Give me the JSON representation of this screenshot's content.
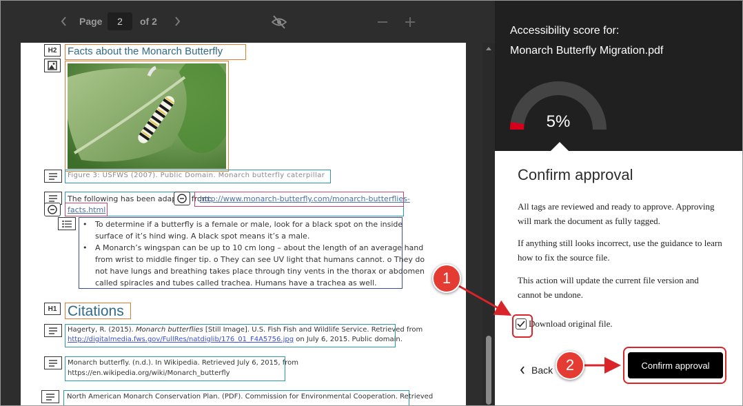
{
  "toolbar": {
    "page_label": "Page",
    "page_value": "2",
    "of_label": "of 2"
  },
  "document": {
    "heading_tag": "H2",
    "heading": "Facts about the Monarch Butterfly",
    "figure_caption": "Figure 3: USFWS (2007). Public Domain. Monarch butterfly caterpillar",
    "para_prefix": "The following has been adapted from:",
    "link_part1": "http://www.monarch-butterfly.com/monarch-butterflies-",
    "link_part2": "facts.html",
    "bullets": [
      [
        "To determine if a butterfly is a female or male, look for a black spot on the inside",
        "surface of it’s hind wing. A black spot means it’s a male."
      ],
      [
        "A Monarch’s wingspan can be up to 10 cm long – about the length of an average hand",
        "from wrist to middle finger tip. o They can see UV light that humans cannot. o They do",
        "not have lungs and breathing takes place through tiny vents in the thorax or abdomen",
        "called spiracles and tubes called trachea. Humans have a trachea as well."
      ]
    ],
    "citations_tag": "H1",
    "citations_heading": "Citations",
    "citation1_a": "Hagerty, R. (2015). ",
    "citation1_italic": "Monarch butterflies",
    "citation1_b": " [Still Image]. U.S. Fish Fish and Wildlife Service. Retrieved from",
    "citation1_link": "http://digitalmedia.fws.gov/FullRes/natdiglib/176_01_F4A5756.jpg",
    "citation1_c": " on July 6, 2015. Public domain.",
    "citation2_line1": "Monarch butterfly. (n.d.). In Wikipedia. Retrieved July 6, 2015, from",
    "citation2_line2": "https://en.wikipedia.org/wiki/Monarch_butterfly",
    "citation3_line1": "North American Monarch Conservation Plan. (PDF). Commission for Environmental Cooperation. Retrieved"
  },
  "panel": {
    "score_title_line1": "Accessibility score for:",
    "score_title_line2": "Monarch Butterfly Migration.pdf",
    "score_value": "5%",
    "score_percent": 5,
    "confirm_title": "Confirm approval",
    "para1": "All tags are reviewed and ready to approve. Approving will mark the document as fully tagged.",
    "para2": "If anything still looks incorrect, use the guidance to learn how to fix the source file.",
    "para3": "This action will update the current file version and cannot be undone.",
    "download_label": "Download original file.",
    "download_checked": true,
    "back_label": "Back",
    "confirm_button": "Confirm approval"
  },
  "callouts": {
    "step1": "1",
    "step2": "2"
  },
  "colors": {
    "callout_red": "#e43b32",
    "gauge_red": "#d6001c",
    "tag_orange": "#e07b2f",
    "tag_teal": "#2a9aa7",
    "tag_pink": "#c8456d",
    "tag_navy": "#3a4d9a"
  }
}
